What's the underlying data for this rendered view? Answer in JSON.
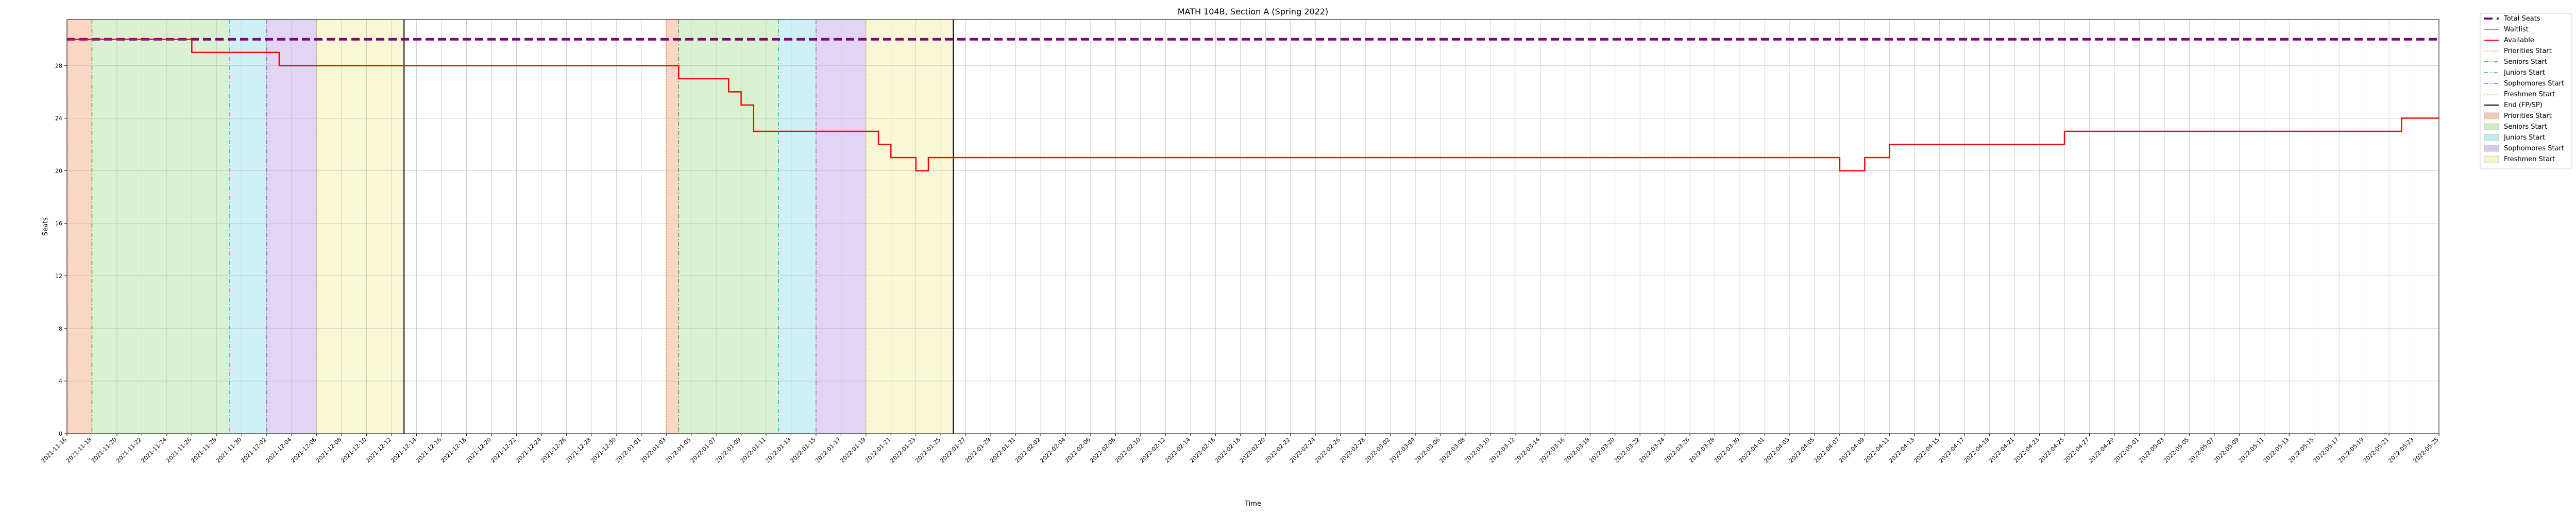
{
  "chart_data": {
    "type": "line",
    "title": "MATH 104B, Section A (Spring 2022)",
    "xlabel": "Time",
    "ylabel": "Seats",
    "ylim": [
      0,
      31.5
    ],
    "yticks": [
      0,
      4,
      8,
      12,
      16,
      20,
      24,
      28
    ],
    "x_dates": [
      "2021-11-16",
      "2022-05-25"
    ],
    "grid": true,
    "legend_position": "outside-upper-right",
    "series": [
      {
        "name": "Total Seats",
        "color": "#800080",
        "style": "dashed-thick",
        "x": [
          "2021-11-16",
          "2022-05-25"
        ],
        "y": [
          30,
          30
        ]
      },
      {
        "name": "Waitlist",
        "color": "#a78bdb",
        "style": "solid",
        "x": [],
        "y": []
      },
      {
        "name": "Available",
        "color": "#ff0000",
        "style": "step",
        "x": [
          "2021-11-16",
          "2021-11-25",
          "2021-11-26",
          "2021-12-02",
          "2021-12-03",
          "2021-12-05",
          "2022-01-04",
          "2022-01-05",
          "2022-01-08",
          "2022-01-09",
          "2022-01-10",
          "2022-01-20",
          "2022-01-21",
          "2022-01-23",
          "2022-01-24",
          "2022-04-07",
          "2022-04-09",
          "2022-04-11",
          "2022-04-25",
          "2022-05-22",
          "2022-05-25"
        ],
        "y": [
          30,
          30,
          29,
          29,
          28,
          28,
          27,
          27,
          26,
          25,
          23,
          22,
          21,
          20,
          21,
          20,
          21,
          22,
          23,
          24,
          24
        ]
      }
    ],
    "phase_lines": [
      {
        "name": "Priorities Start",
        "color": "#ff7f0e",
        "style": "dotted"
      },
      {
        "name": "Seniors Start",
        "color": "#2ca02c",
        "style": "dashdot"
      },
      {
        "name": "Juniors Start",
        "color": "#17becf",
        "style": "dashdot"
      },
      {
        "name": "Sophomores Start",
        "color": "#9467bd",
        "style": "dashdot"
      },
      {
        "name": "Freshmen Start",
        "color": "#bcbd22",
        "style": "dotted"
      },
      {
        "name": "End (FP/SP)",
        "color": "#000000",
        "style": "solid"
      }
    ],
    "phase_spans": [
      {
        "name": "Priorities Start",
        "color": "#f7c9b0"
      },
      {
        "name": "Seniors Start",
        "color": "#cdeec2"
      },
      {
        "name": "Juniors Start",
        "color": "#bfecf2"
      },
      {
        "name": "Sophomores Start",
        "color": "#d8c6f0"
      },
      {
        "name": "Freshmen Start",
        "color": "#f6f6c8"
      }
    ],
    "registration_periods": [
      {
        "priorities": "2021-11-16",
        "seniors": "2021-11-18",
        "juniors": "2021-11-29",
        "sophomores": "2021-12-02",
        "freshmen": "2021-12-06",
        "end": "2021-12-13"
      },
      {
        "priorities": "2022-01-03",
        "seniors": "2022-01-04",
        "juniors": "2022-01-12",
        "sophomores": "2022-01-15",
        "freshmen": "2022-01-19",
        "end": "2022-01-26"
      }
    ]
  }
}
